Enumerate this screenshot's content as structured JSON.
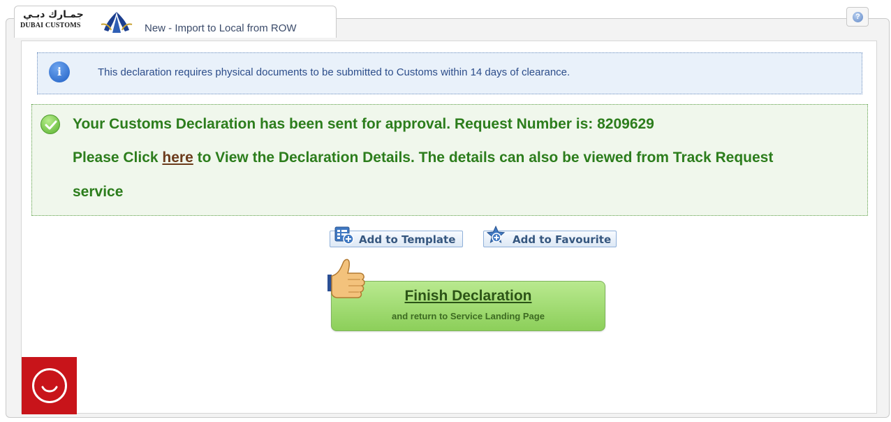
{
  "header": {
    "logo_arabic": "جمـارك دبـي",
    "logo_english": "DUBAI CUSTOMS",
    "tab_title": "New - Import to Local from ROW",
    "help_icon": "help-icon"
  },
  "info_banner": {
    "icon": "info-icon",
    "text": "This declaration requires physical documents to be submitted to Customs within 14 days of clearance."
  },
  "success_banner": {
    "icon": "check-icon",
    "line1": "Your Customs Declaration has been sent for approval. Request Number is: 8209629",
    "line2_prefix": "Please Click ",
    "line2_link": "here",
    "line2_suffix": " to View the Declaration Details. The details can also be viewed from Track Request",
    "line3": "service"
  },
  "actions": {
    "add_template_label": "Add to Template",
    "add_favourite_label": "Add to Favourite",
    "finish_title": "Finish Declaration",
    "finish_subtitle": "and return to Service Landing Page"
  },
  "colors": {
    "success_text": "#2c7d1c",
    "info_text": "#2c4d8a",
    "chat_widget": "#c8141a"
  }
}
